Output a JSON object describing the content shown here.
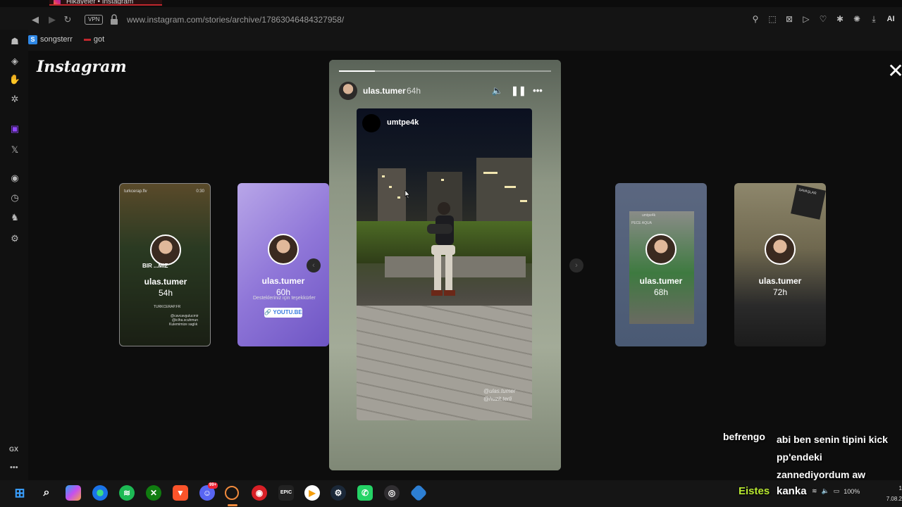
{
  "browser": {
    "tab_title": "Hikayeler • Instagram",
    "url": "www.instagram.com/stories/archive/17863046484327958/",
    "vpn_label": "VPN",
    "ai_label": "AI",
    "bookmarks": [
      {
        "label": "songsterr",
        "icon": "songsterr-icon"
      },
      {
        "label": "got",
        "icon": "dash-icon"
      }
    ]
  },
  "sidebar": {
    "gx_label": "GX",
    "more_label": "•••",
    "icons": [
      "gx-corner-icon",
      "ai-icon",
      "hand-icon",
      "star-icon",
      "twitch-icon",
      "x-icon",
      "spotify-icon",
      "clock-icon",
      "figure-icon",
      "settings-icon"
    ]
  },
  "instagram": {
    "logo": "Instagram",
    "close_label": "✕",
    "player": {
      "username": "ulas.tumer",
      "age": "64h",
      "progress": 0.17,
      "reposted_user": "umtpe4k",
      "tag_line1": "@ulas.tumer",
      "tag_line2": "@huzit.terli"
    },
    "left_cards": [
      {
        "username": "ulas.tumer",
        "age": "54h",
        "top_label": "turkcerap.flv",
        "corner": "0:30",
        "caption": "BIR ...MIZ",
        "footer": "TURKCERAP.FR",
        "credits_1": "@cavcavgulucmir",
        "credits_2": "@iclha.scuhmun",
        "credits_3": "Kulemimize saglık"
      },
      {
        "username": "ulas.tumer",
        "age": "60h",
        "caption": "Destekleriniz için teşekkürler",
        "link_label": "🔗 YOUTU.BE"
      }
    ],
    "right_cards": [
      {
        "username": "ulas.tumer",
        "age": "68h",
        "top_label": "umtpe4k",
        "sub_label": "PECE AQUA"
      },
      {
        "username": "ulas.tumer",
        "age": "72h",
        "sticker": "SAVAŞLAR"
      }
    ]
  },
  "chat": {
    "user": "befrengo",
    "message": "abi ben senin tipini kick pp'endeki zannediyordum aw",
    "user2": "Eistes",
    "message2": "kanka"
  },
  "taskbar": {
    "apps": [
      "windows-start-icon",
      "search-icon",
      "copilot-icon",
      "edge-icon",
      "spotify-icon",
      "xbox-icon",
      "brave-icon",
      "discord-icon",
      "opera-gx-icon",
      "gx-red-icon",
      "epic-games-icon",
      "media-player-icon",
      "steam-icon",
      "whatsapp-icon",
      "obs-icon",
      "app-icon"
    ],
    "discord_badge": "99+",
    "epic_label": "EPIC",
    "battery": "100%",
    "time": "1",
    "date": "7.08.2"
  }
}
